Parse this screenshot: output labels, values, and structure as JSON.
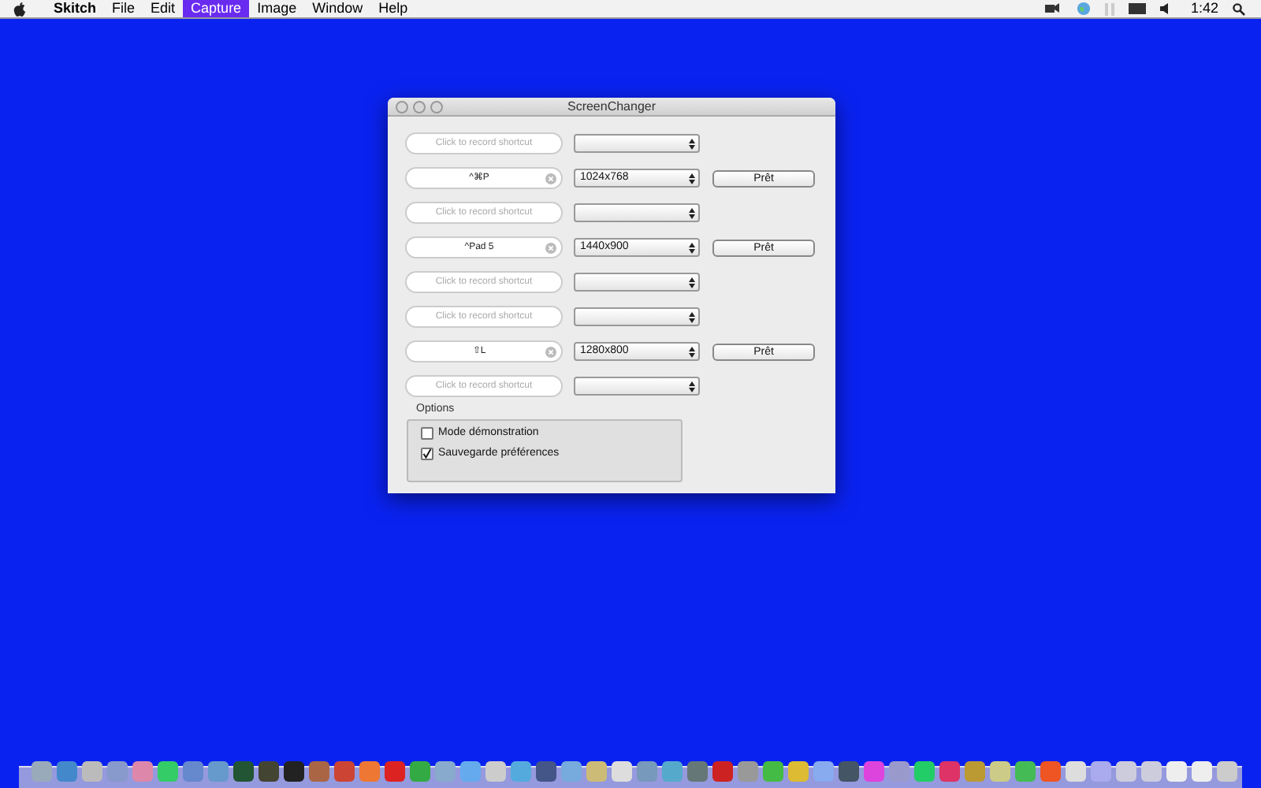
{
  "menu_bar": {
    "app_name": "Skitch",
    "menus": [
      {
        "label": "File",
        "selected": false
      },
      {
        "label": "Edit",
        "selected": false
      },
      {
        "label": "Capture",
        "selected": true
      },
      {
        "label": "Image",
        "selected": false
      },
      {
        "label": "Window",
        "selected": false
      },
      {
        "label": "Help",
        "selected": false
      }
    ],
    "clock": "1:42"
  },
  "window": {
    "title": "ScreenChanger",
    "rows": [
      {
        "shortcut": {
          "placeholder": "Click to record shortcut"
        },
        "resolution": ""
      },
      {
        "shortcut": {
          "value": "^⌘P"
        },
        "resolution": "1024x768",
        "button": "Prêt"
      },
      {
        "shortcut": {
          "placeholder": "Click to record shortcut"
        },
        "resolution": ""
      },
      {
        "shortcut": {
          "value": "^Pad 5"
        },
        "resolution": "1440x900",
        "button": "Prêt"
      },
      {
        "shortcut": {
          "placeholder": "Click to record shortcut"
        },
        "resolution": ""
      },
      {
        "shortcut": {
          "placeholder": "Click to record shortcut"
        },
        "resolution": ""
      },
      {
        "shortcut": {
          "value": "⇧L"
        },
        "resolution": "1280x800",
        "button": "Prêt"
      },
      {
        "shortcut": {
          "placeholder": "Click to record shortcut"
        },
        "resolution": ""
      }
    ],
    "options": {
      "title": "Options",
      "checkboxes": [
        {
          "label": "Mode démonstration",
          "checked": false
        },
        {
          "label": "Sauvegarde préférences",
          "checked": true
        }
      ]
    }
  }
}
